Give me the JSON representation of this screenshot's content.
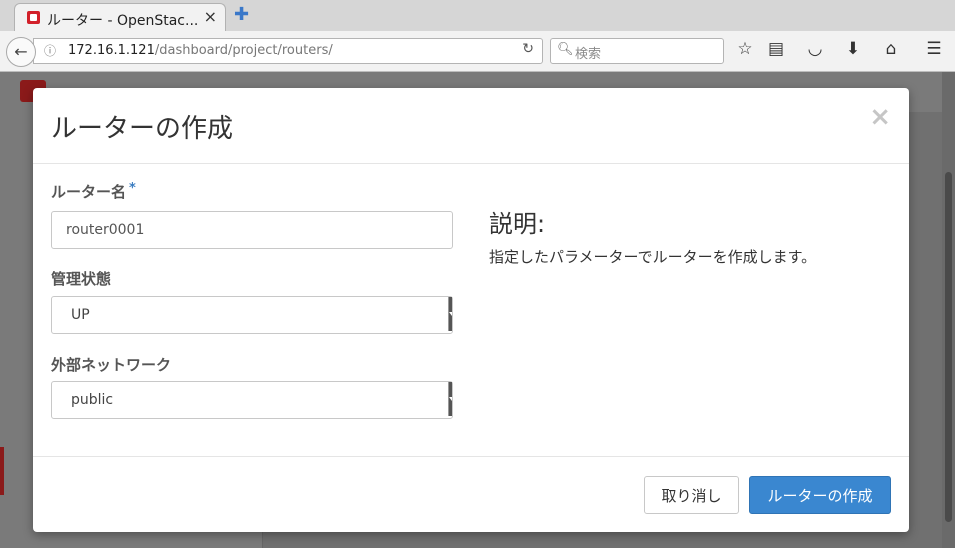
{
  "browser": {
    "tab_title": "ルーター - OpenStac...",
    "url_host": "172.16.1.121",
    "url_path": "/dashboard/project/routers/",
    "search_placeholder": "検索"
  },
  "modal": {
    "title": "ルーターの作成",
    "fields": [
      {
        "label": "ルーター名",
        "required_mark": "*",
        "value": "router0001"
      },
      {
        "label": "管理状態",
        "value": "UP"
      },
      {
        "label": "外部ネットワーク",
        "value": "public"
      }
    ],
    "description_heading": "説明:",
    "description_text": "指定したパラメーターでルーターを作成します。",
    "cancel_label": "取り消し",
    "submit_label": "ルーターの作成"
  },
  "colors": {
    "primary": "#3a87d0",
    "required": "#3a7cc0",
    "brand": "#d2202a"
  }
}
